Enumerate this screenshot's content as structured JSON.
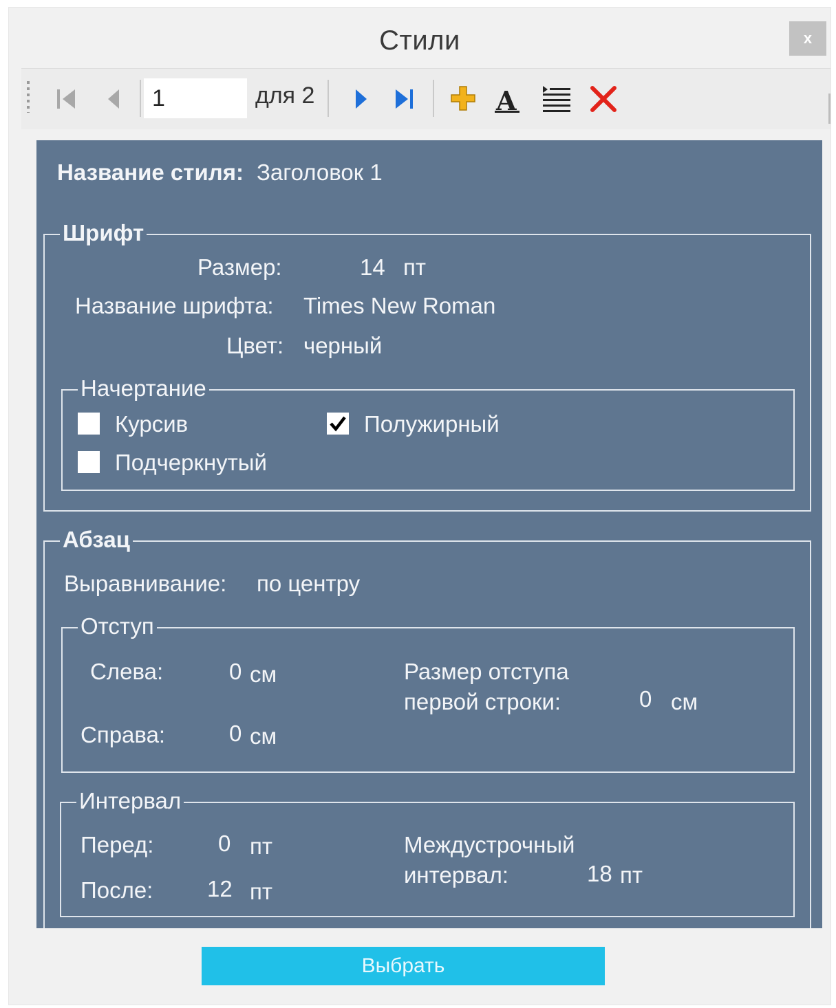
{
  "window": {
    "title": "Стили",
    "close_label": "x"
  },
  "toolbar": {
    "page_current": "1",
    "of_total": "для 2",
    "icons": [
      "first-icon",
      "prev-icon",
      "next-icon",
      "last-icon",
      "add-icon",
      "font-icon",
      "paragraph-icon",
      "delete-icon"
    ],
    "colors": {
      "nav_disabled": "#a8a8a8",
      "nav_active": "#1e6fd9",
      "add": "#f2b21b",
      "delete": "#e2231a"
    }
  },
  "style": {
    "name_label": "Название стиля:",
    "name_value": "Заголовок 1"
  },
  "font": {
    "legend": "Шрифт",
    "size_label": "Размер:",
    "size_value": "14",
    "size_unit": "пт",
    "name_label": "Название шрифта:",
    "name_value": "Times New Roman",
    "color_label": "Цвет:",
    "color_value": "черный",
    "style_group": {
      "legend": "Начертание",
      "italic_label": "Курсив",
      "italic_checked": false,
      "bold_label": "Полужирный",
      "bold_checked": true,
      "underline_label": "Подчеркнутый",
      "underline_checked": false
    }
  },
  "paragraph": {
    "legend": "Абзац",
    "align_label": "Выравнивание:",
    "align_value": "по центру",
    "indent": {
      "legend": "Отступ",
      "left_label": "Слева:",
      "left_value": "0",
      "left_unit": "см",
      "right_label": "Справа:",
      "right_value": "0",
      "right_unit": "см",
      "first_line_label_1": "Размер отступа",
      "first_line_label_2": "первой строки:",
      "first_line_value": "0",
      "first_line_unit": "см"
    },
    "spacing": {
      "legend": "Интервал",
      "before_label": "Перед:",
      "before_value": "0",
      "before_unit": "пт",
      "after_label": "После:",
      "after_value": "12",
      "after_unit": "пт",
      "line_label_1": "Междустрочный",
      "line_label_2": "интервал:",
      "line_value": "18",
      "line_unit": "пт"
    }
  },
  "actions": {
    "select_label": "Выбрать"
  },
  "colors": {
    "panel_bg": "#5f7690",
    "button_bg": "#20c0e8"
  }
}
